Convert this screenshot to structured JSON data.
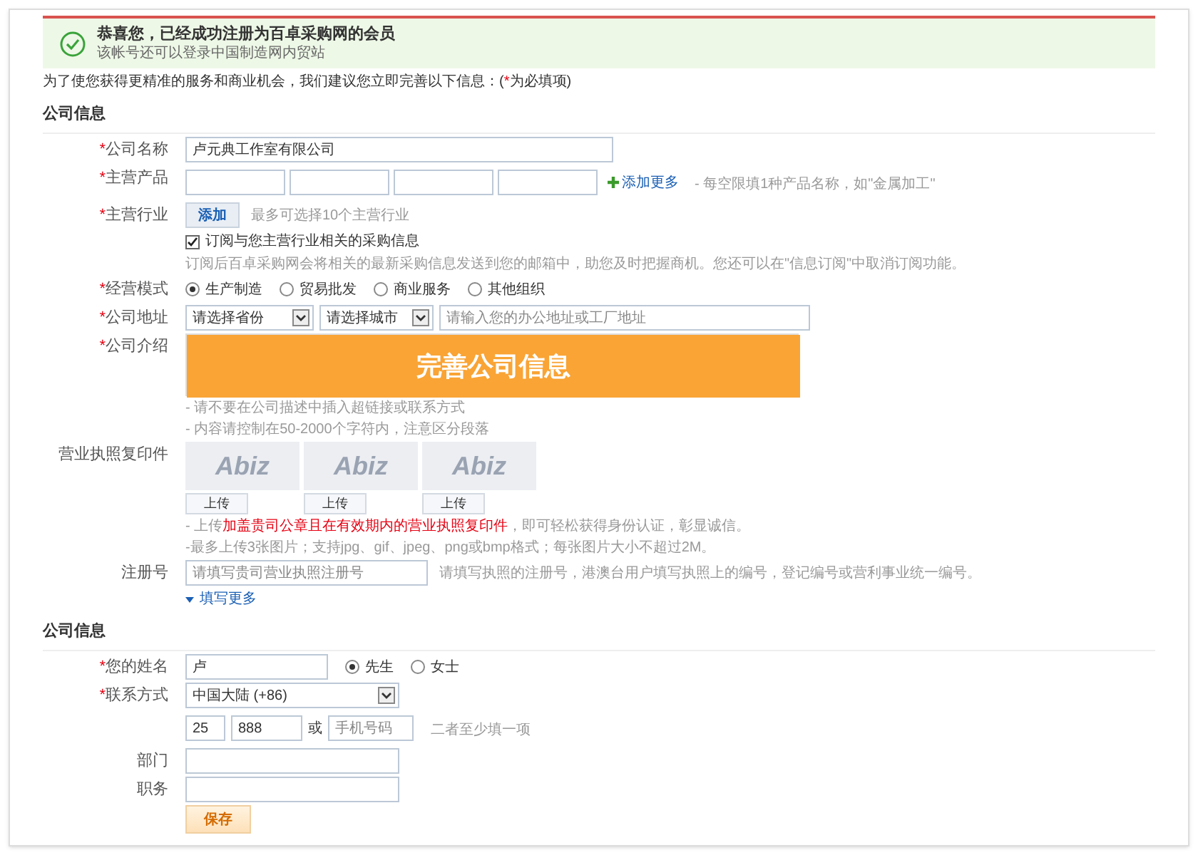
{
  "banner": {
    "title": "恭喜您，已经成功注册为百卓采购网的会员",
    "subtitle": "该帐号还可以登录中国制造网内贸站"
  },
  "intro": {
    "before": "为了使您获得更精准的服务和商业机会，我们建议您立即完善以下信息：(",
    "mark": "*",
    "after": "为必填项)"
  },
  "company_section": {
    "title": "公司信息"
  },
  "company_name": {
    "label": "公司名称",
    "required": true,
    "value": "卢元典工作室有限公司"
  },
  "main_products": {
    "label": "主营产品",
    "required": true,
    "add_more": "添加更多",
    "hint": "- 每空限填1种产品名称，如\"金属加工\""
  },
  "main_industry": {
    "label": "主营行业",
    "required": true,
    "button": "添加",
    "hint": "最多可选择10个主营行业",
    "subscribe": {
      "label": "订阅与您主营行业相关的采购信息",
      "checked": true
    },
    "subscribe_hint": "订阅后百卓采购网会将相关的最新采购信息发送到您的邮箱中，助您及时把握商机。您还可以在\"信息订阅\"中取消订阅功能。"
  },
  "business_mode": {
    "label": "经营模式",
    "required": true,
    "options": [
      {
        "label": "生产制造",
        "selected": true
      },
      {
        "label": "贸易批发",
        "selected": false
      },
      {
        "label": "商业服务",
        "selected": false
      },
      {
        "label": "其他组织",
        "selected": false
      }
    ]
  },
  "address": {
    "label": "公司地址",
    "required": true,
    "province": "请选择省份",
    "city": "请选择城市",
    "placeholder": "请输入您的办公地址或工厂地址"
  },
  "company_intro": {
    "label": "公司介绍",
    "required": true,
    "hints": [
      "- 请不要在公司描述中插入超链接或联系方式",
      "- 内容请控制在50-2000个字符内，注意区分段落"
    ]
  },
  "overlay": {
    "title": "完善公司信息"
  },
  "license": {
    "label": "营业执照复印件",
    "required": false,
    "slots": [
      {
        "logo": "Abiz",
        "button": "上传"
      },
      {
        "logo": "Abiz",
        "button": "上传"
      },
      {
        "logo": "Abiz",
        "button": "上传"
      }
    ],
    "hint_before": "- 上传",
    "hint_highlight": "加盖贵司公章且在有效期内的营业执照复印件",
    "hint_after": "，即可轻松获得身份认证，彰显诚信。",
    "hint2": "-最多上传3张图片；支持jpg、gif、jpeg、png或bmp格式；每张图片大小不超过2M。"
  },
  "reg_number": {
    "label": "注册号",
    "required": false,
    "placeholder": "请填写贵司营业执照注册号",
    "hint": "请填写执照的注册号，港澳台用户填写执照上的编号，登记编号或营利事业统一编号。"
  },
  "fill_more": "填写更多",
  "contact_section": {
    "title": "公司信息"
  },
  "your_name": {
    "label": "您的姓名",
    "required": true,
    "value": "卢",
    "options": [
      {
        "label": "先生",
        "selected": true
      },
      {
        "label": "女士",
        "selected": false
      }
    ]
  },
  "contact": {
    "label": "联系方式",
    "required": true,
    "country": "中国大陆 (+86)",
    "area_code": "25",
    "phone": "888",
    "or": "或",
    "mobile_placeholder": "手机号码",
    "hint": "二者至少填一项"
  },
  "department": {
    "label": "部门",
    "required": false
  },
  "position": {
    "label": "职务",
    "required": false
  },
  "save": "保存"
}
